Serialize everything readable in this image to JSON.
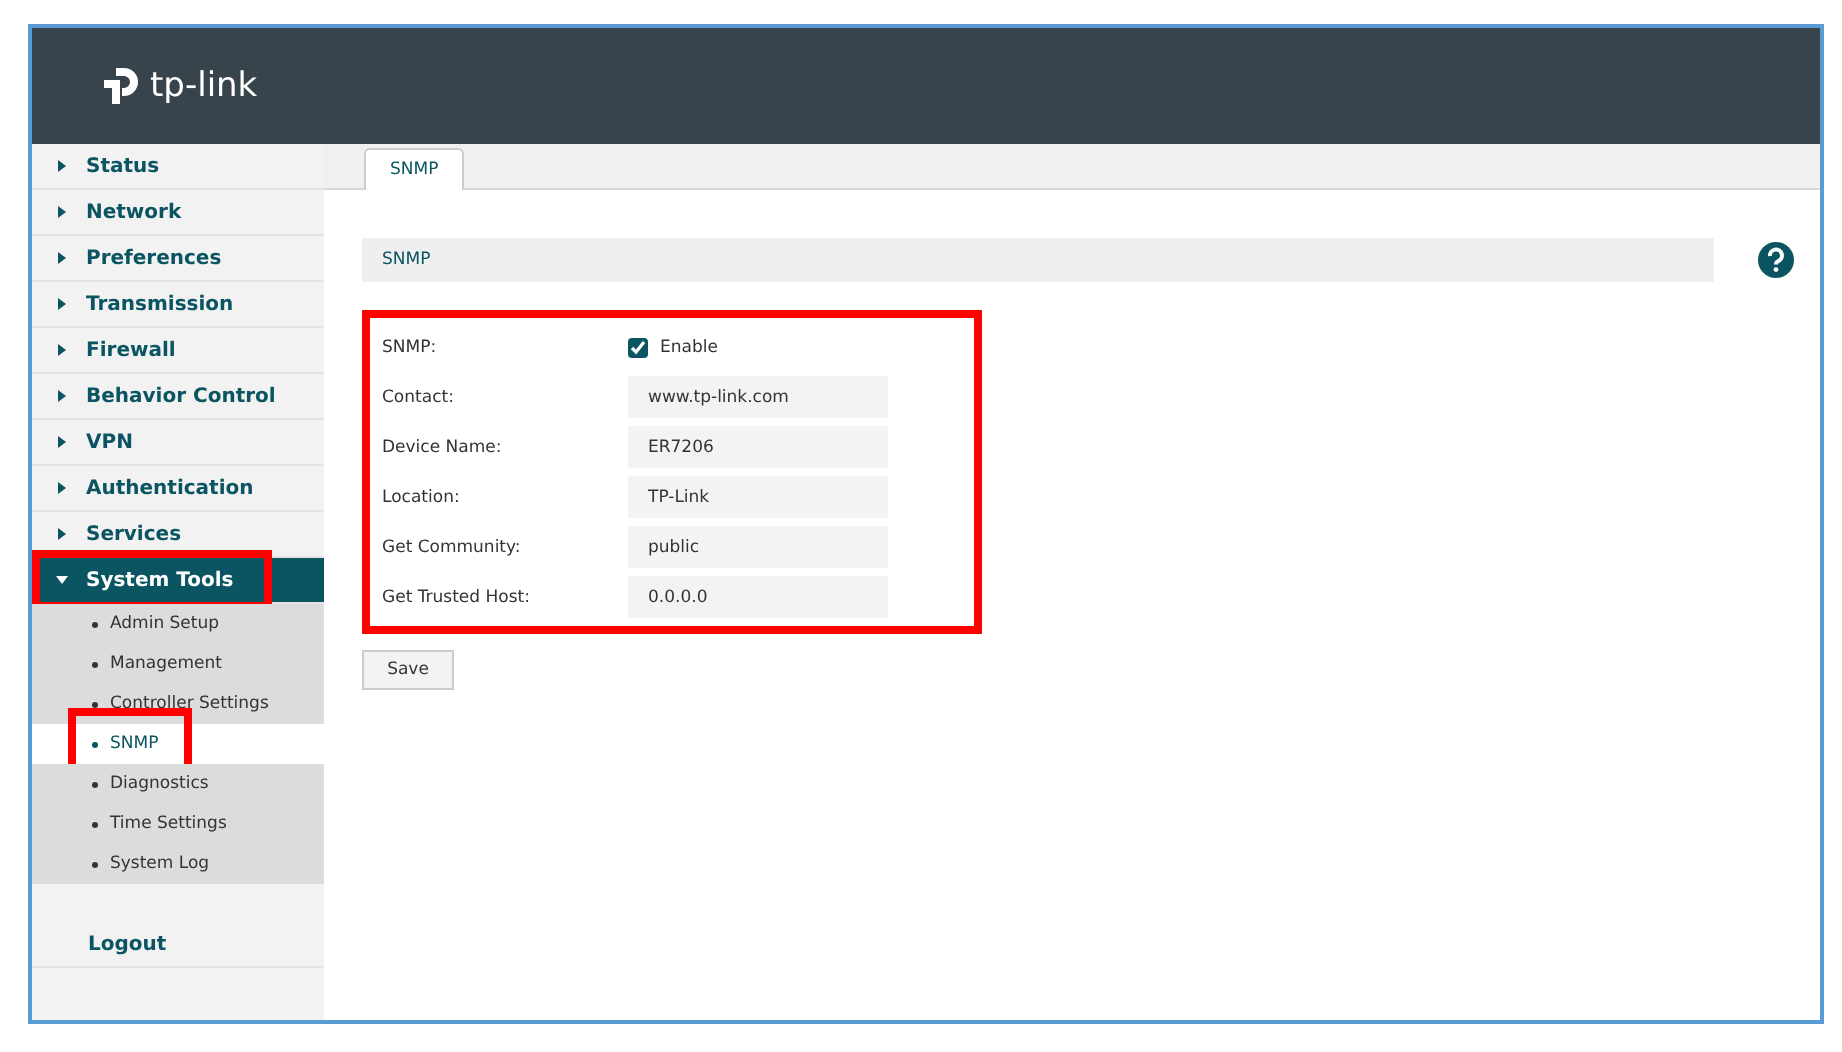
{
  "brand": {
    "name": "tp-link"
  },
  "sidebar": {
    "items": [
      {
        "label": "Status",
        "expanded": false,
        "highlighted": false
      },
      {
        "label": "Network",
        "expanded": false,
        "highlighted": false
      },
      {
        "label": "Preferences",
        "expanded": false,
        "highlighted": false
      },
      {
        "label": "Transmission",
        "expanded": false,
        "highlighted": false
      },
      {
        "label": "Firewall",
        "expanded": false,
        "highlighted": false
      },
      {
        "label": "Behavior Control",
        "expanded": false,
        "highlighted": false
      },
      {
        "label": "VPN",
        "expanded": false,
        "highlighted": false
      },
      {
        "label": "Authentication",
        "expanded": false,
        "highlighted": false
      },
      {
        "label": "Services",
        "expanded": false,
        "highlighted": false
      },
      {
        "label": "System Tools",
        "expanded": true,
        "highlighted": true,
        "children": [
          {
            "label": "Admin Setup",
            "selected": false,
            "highlighted": false
          },
          {
            "label": "Management",
            "selected": false,
            "highlighted": false
          },
          {
            "label": "Controller Settings",
            "selected": false,
            "highlighted": false
          },
          {
            "label": "SNMP",
            "selected": true,
            "highlighted": true
          },
          {
            "label": "Diagnostics",
            "selected": false,
            "highlighted": false
          },
          {
            "label": "Time Settings",
            "selected": false,
            "highlighted": false
          },
          {
            "label": "System Log",
            "selected": false,
            "highlighted": false
          }
        ]
      }
    ],
    "logout": "Logout"
  },
  "tabs": [
    {
      "label": "SNMP",
      "selected": true
    }
  ],
  "section": {
    "title": "SNMP"
  },
  "form": {
    "highlighted": true,
    "rows": [
      {
        "kind": "checkbox",
        "label": "SNMP:",
        "option": "Enable",
        "checked": true
      },
      {
        "kind": "text",
        "label": "Contact:",
        "value": "www.tp-link.com"
      },
      {
        "kind": "text",
        "label": "Device Name:",
        "value": "ER7206"
      },
      {
        "kind": "text",
        "label": "Location:",
        "value": "TP-Link"
      },
      {
        "kind": "text",
        "label": "Get Community:",
        "value": "public"
      },
      {
        "kind": "text",
        "label": "Get Trusted Host:",
        "value": "0.0.0.0"
      }
    ]
  },
  "buttons": [
    "Save"
  ]
}
